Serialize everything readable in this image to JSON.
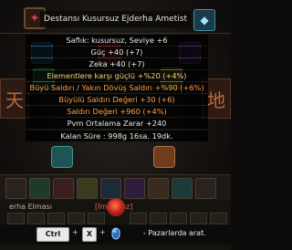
{
  "tooltip": {
    "title": "Destansı Kusursuz Ejderha Ametist",
    "lines": [
      {
        "text": "Saflık: kusursuz, Seviye +6",
        "color": "#e8e8e8"
      },
      {
        "text": "Güç +40 (+7)",
        "color": "#e8e8e8"
      },
      {
        "text": "Zeka +40 (+7)",
        "color": "#e8e8e8"
      },
      {
        "text": "Elementlere karşı güçlü +%20 (+4%)",
        "color": "#f2d77a"
      },
      {
        "text": "Büyü Saldırı / Yakın Dövüş Saldırı +%90 (+6%)",
        "color": "#ff9d4a"
      },
      {
        "text": "Büyülü Saldırı Değeri +30 (+6)",
        "color": "#ff9d4a"
      },
      {
        "text": "Saldırı Değeri +960 (+4%)",
        "color": "#ff9d4a"
      },
      {
        "text": "Pvm Ortalama Zarar +240",
        "color": "#e8e8e8"
      },
      {
        "text": "Kalan Süre : 998g 16sa. 19dk.",
        "color": "#e8e8e8"
      }
    ]
  },
  "background": {
    "left_ornament": "天",
    "right_ornament": "地"
  },
  "gem_panel": {
    "name": "erha Elması",
    "status": "[İmkansız]"
  },
  "hint": {
    "key1": "Ctrl",
    "plus1": "+",
    "key2": "X",
    "plus2": "+",
    "text": "- Pazarlarda arat."
  },
  "icons": {
    "header_icon": "dragon-emblem-icon",
    "badge_icon": "blue-badge-icon",
    "mouse_icon": "mouse-icon",
    "center_gem": "red-gem-icon"
  }
}
